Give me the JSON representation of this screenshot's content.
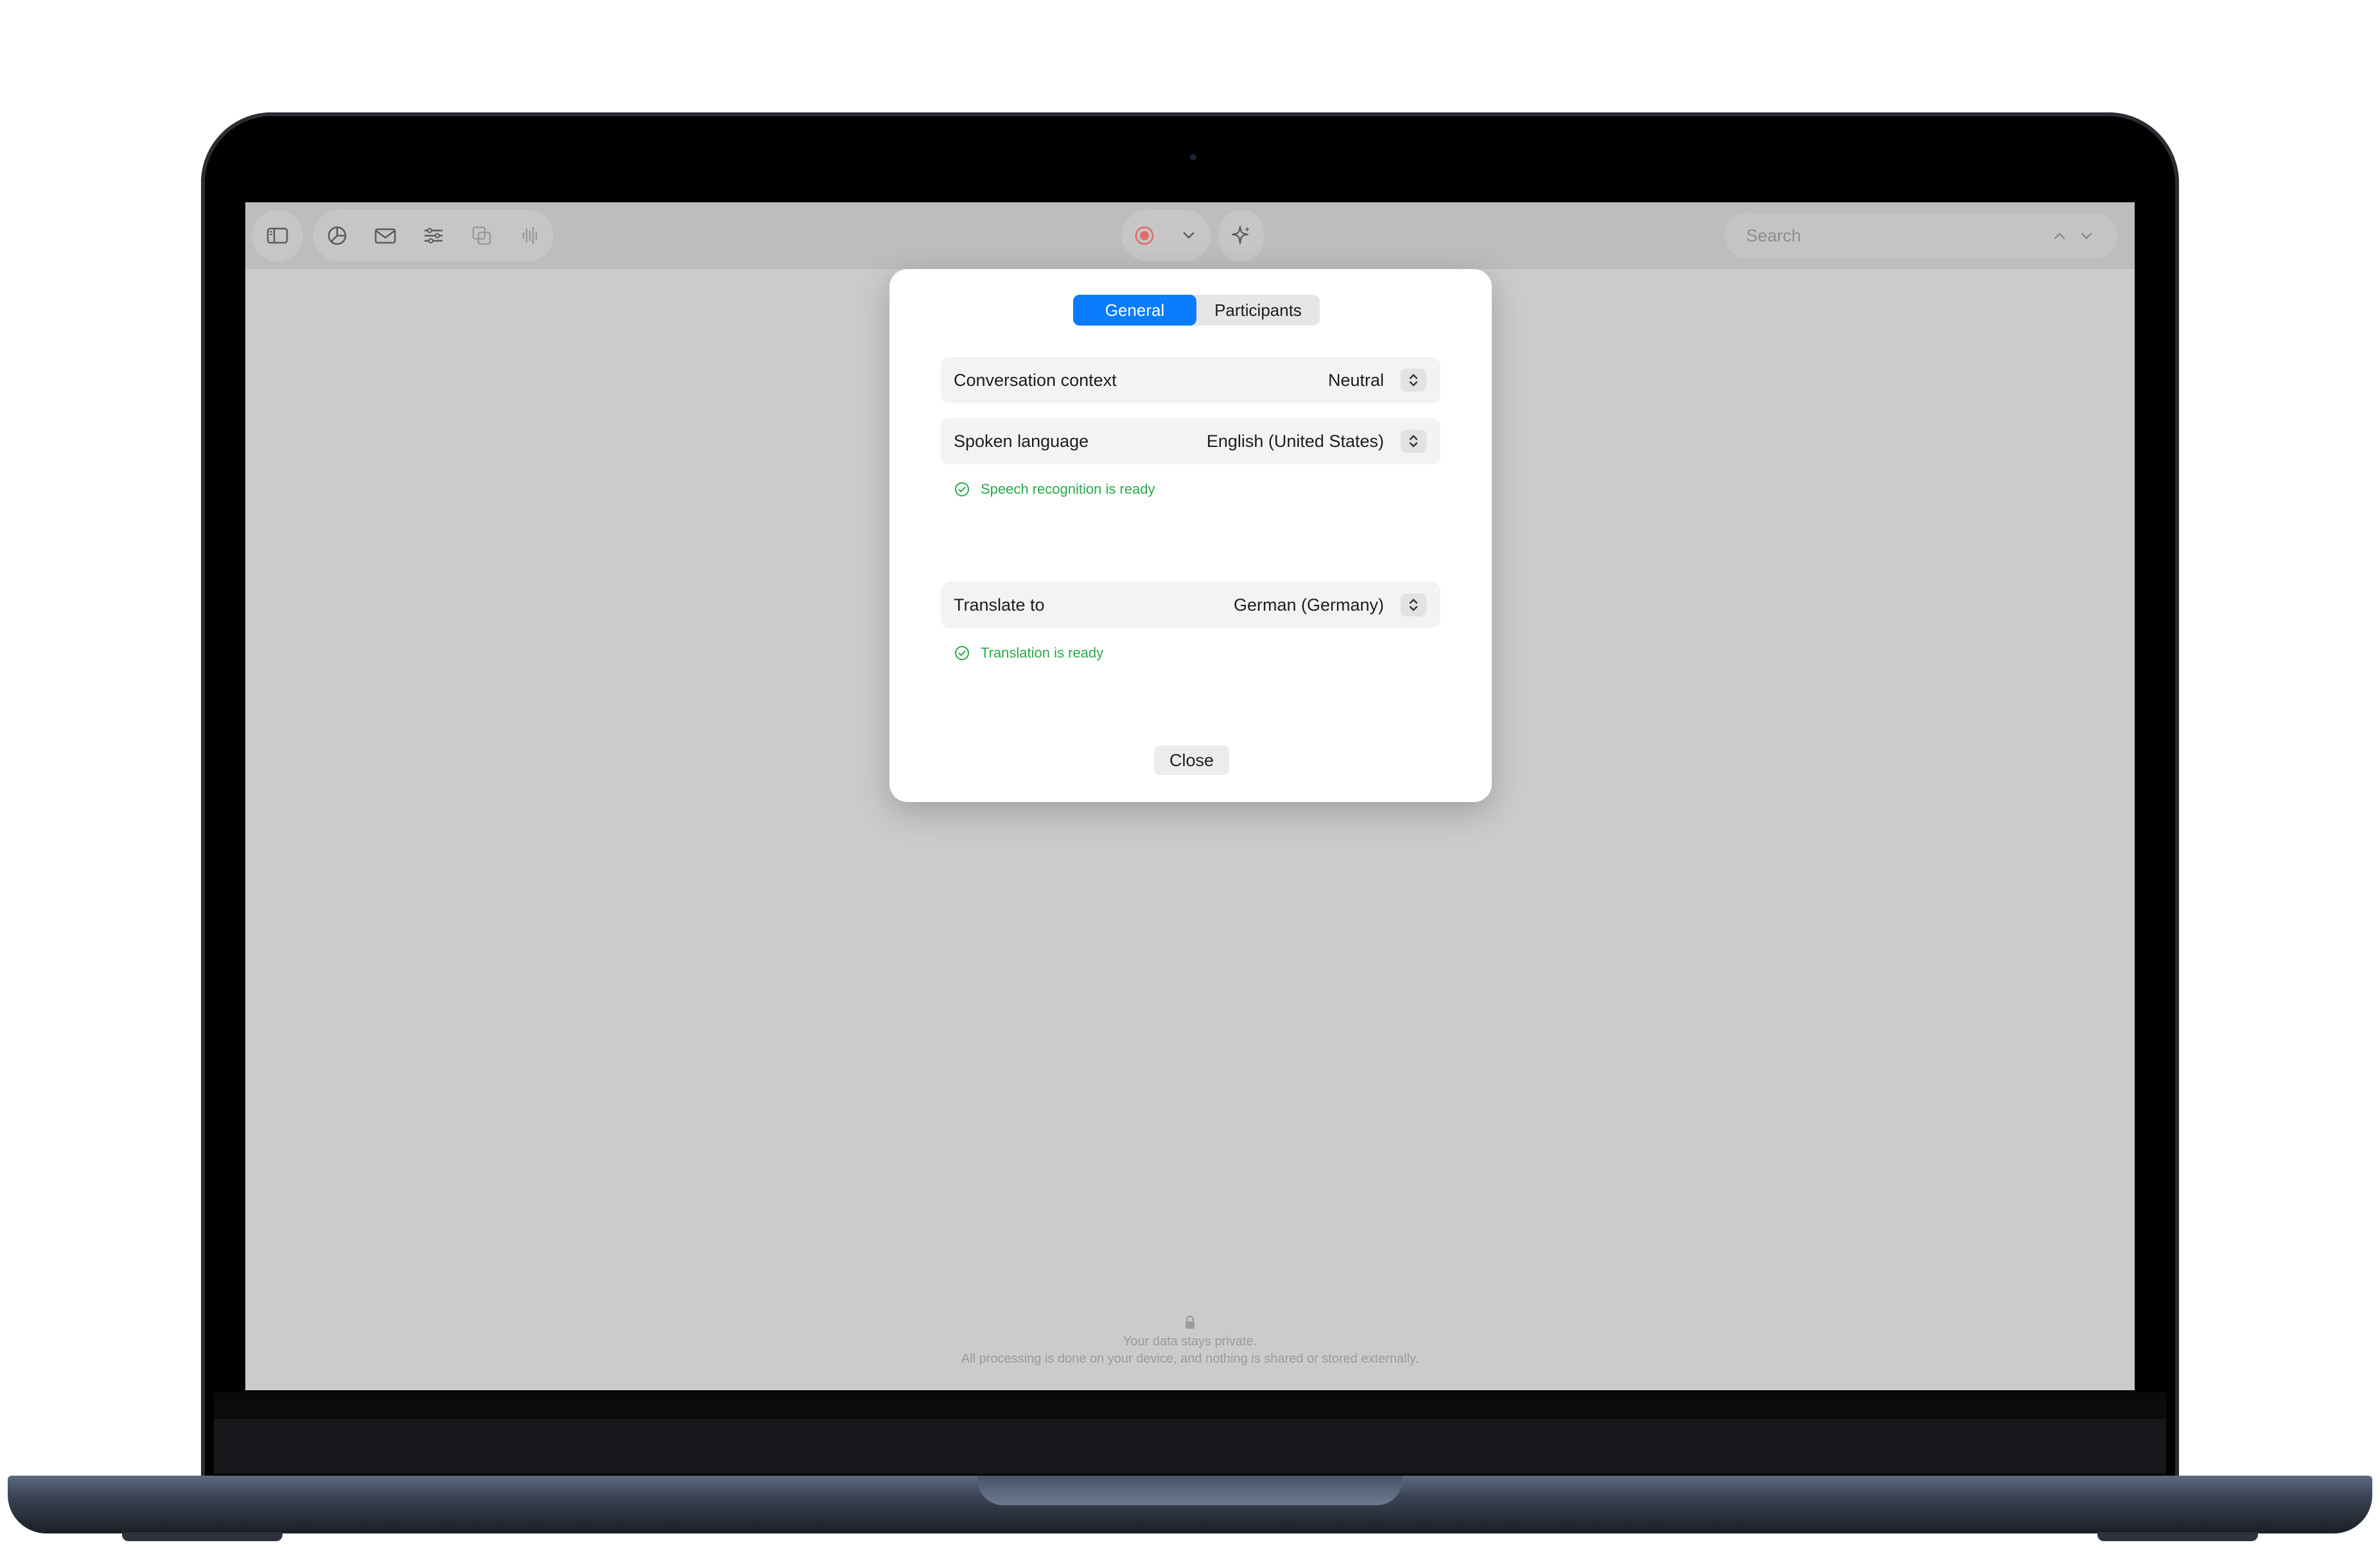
{
  "toolbar": {
    "left_icons": [
      "sidebar-icon",
      "chart-icon",
      "mail-icon",
      "sliders-icon",
      "copy-icon",
      "waveform-icon"
    ],
    "center_icons": [
      "record-icon",
      "chevron-down-icon",
      "sparkle-icon"
    ],
    "search": {
      "placeholder": "Search"
    },
    "colors": {
      "record": "#e26a6a"
    }
  },
  "dialog": {
    "tabs": [
      {
        "label": "General",
        "selected": true
      },
      {
        "label": "Participants",
        "selected": false
      }
    ],
    "settings": [
      {
        "label": "Conversation context",
        "value": "Neutral"
      },
      {
        "label": "Spoken language",
        "value": "English (United States)"
      },
      {
        "label": "Translate to",
        "value": "German (Germany)"
      }
    ],
    "speech_status": "Speech recognition is ready",
    "translation_status": "Translation is ready",
    "close_label": "Close",
    "colors": {
      "accent": "#0a7cff",
      "ready": "#2aa84a"
    }
  },
  "footer": {
    "line1": "Your data stays private.",
    "line2": "All processing is done on your device, and nothing is shared or stored externally."
  }
}
